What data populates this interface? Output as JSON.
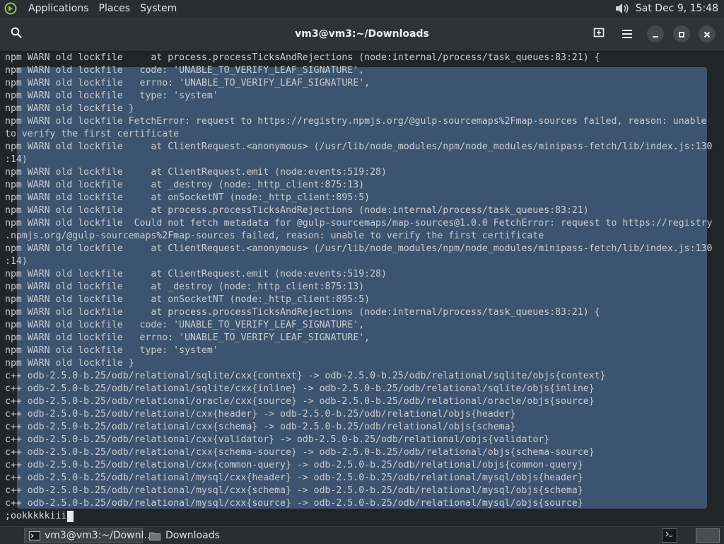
{
  "top_panel": {
    "menus": [
      "Applications",
      "Places",
      "System"
    ],
    "clock": "Sat Dec  9, 15:48"
  },
  "header": {
    "title": "vm3@vm3:~/Downloads"
  },
  "terminal": {
    "lines": [
      "npm WARN old lockfile     at process.processTicksAndRejections (node:internal/process/task_queues:83:21) {",
      "npm WARN old lockfile   code: 'UNABLE_TO_VERIFY_LEAF_SIGNATURE',",
      "npm WARN old lockfile   errno: 'UNABLE_TO_VERIFY_LEAF_SIGNATURE',",
      "npm WARN old lockfile   type: 'system'",
      "npm WARN old lockfile }",
      "npm WARN old lockfile FetchError: request to https://registry.npmjs.org/@gulp-sourcemaps%2Fmap-sources failed, reason: unable",
      "to verify the first certificate",
      "npm WARN old lockfile     at ClientRequest.<anonymous> (/usr/lib/node_modules/npm/node_modules/minipass-fetch/lib/index.js:130",
      ":14)",
      "npm WARN old lockfile     at ClientRequest.emit (node:events:519:28)",
      "npm WARN old lockfile     at _destroy (node:_http_client:875:13)",
      "npm WARN old lockfile     at onSocketNT (node:_http_client:895:5)",
      "npm WARN old lockfile     at process.processTicksAndRejections (node:internal/process/task_queues:83:21)",
      "npm WARN old lockfile  Could not fetch metadata for @gulp-sourcemaps/map-sources@1.0.0 FetchError: request to https://registry",
      ".npmjs.org/@gulp-sourcemaps%2Fmap-sources failed, reason: unable to verify the first certificate",
      "npm WARN old lockfile     at ClientRequest.<anonymous> (/usr/lib/node_modules/npm/node_modules/minipass-fetch/lib/index.js:130",
      ":14)",
      "npm WARN old lockfile     at ClientRequest.emit (node:events:519:28)",
      "npm WARN old lockfile     at _destroy (node:_http_client:875:13)",
      "npm WARN old lockfile     at onSocketNT (node:_http_client:895:5)",
      "npm WARN old lockfile     at process.processTicksAndRejections (node:internal/process/task_queues:83:21) {",
      "npm WARN old lockfile   code: 'UNABLE_TO_VERIFY_LEAF_SIGNATURE',",
      "npm WARN old lockfile   errno: 'UNABLE_TO_VERIFY_LEAF_SIGNATURE',",
      "npm WARN old lockfile   type: 'system'",
      "npm WARN old lockfile }",
      "c++ odb-2.5.0-b.25/odb/relational/sqlite/cxx{context} -> odb-2.5.0-b.25/odb/relational/sqlite/objs{context}",
      "c++ odb-2.5.0-b.25/odb/relational/sqlite/cxx{inline} -> odb-2.5.0-b.25/odb/relational/sqlite/objs{inline}",
      "c++ odb-2.5.0-b.25/odb/relational/oracle/cxx{source} -> odb-2.5.0-b.25/odb/relational/oracle/objs{source}",
      "c++ odb-2.5.0-b.25/odb/relational/cxx{header} -> odb-2.5.0-b.25/odb/relational/objs{header}",
      "c++ odb-2.5.0-b.25/odb/relational/cxx{schema} -> odb-2.5.0-b.25/odb/relational/objs{schema}",
      "c++ odb-2.5.0-b.25/odb/relational/cxx{validator} -> odb-2.5.0-b.25/odb/relational/objs{validator}",
      "c++ odb-2.5.0-b.25/odb/relational/cxx{schema-source} -> odb-2.5.0-b.25/odb/relational/objs{schema-source}",
      "c++ odb-2.5.0-b.25/odb/relational/cxx{common-query} -> odb-2.5.0-b.25/odb/relational/objs{common-query}",
      "c++ odb-2.5.0-b.25/odb/relational/mysql/cxx{header} -> odb-2.5.0-b.25/odb/relational/mysql/objs{header}",
      "c++ odb-2.5.0-b.25/odb/relational/mysql/cxx{schema} -> odb-2.5.0-b.25/odb/relational/mysql/objs{schema}",
      "c++ odb-2.5.0-b.25/odb/relational/mysql/cxx{source} -> odb-2.5.0-b.25/odb/relational/mysql/objs{source}"
    ],
    "input": ";ookkkkkiii"
  },
  "taskbar": {
    "tasks": [
      {
        "label": "vm3@vm3:~/Downl…",
        "icon": "terminal-icon",
        "active": true
      },
      {
        "label": "Downloads",
        "icon": "folder-icon",
        "active": false
      }
    ]
  },
  "colors": {
    "terminal_bg": "#212528",
    "selection": "#3d5470",
    "panel": "#2b2e31"
  }
}
